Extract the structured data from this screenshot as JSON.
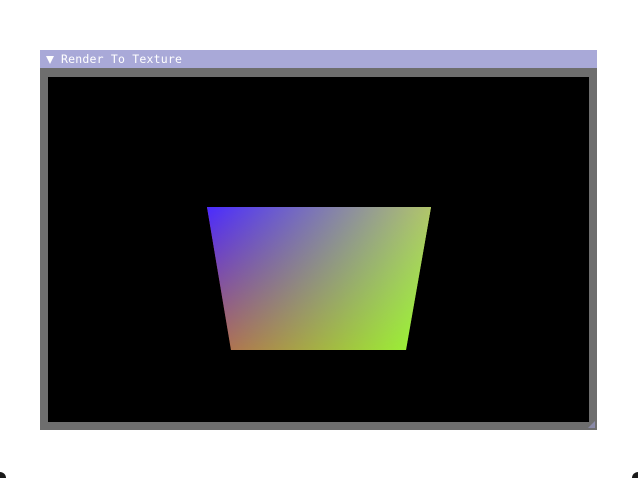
{
  "window": {
    "title": "Render To Texture",
    "collapse_icon": "triangle-down-icon",
    "resize_icon": "resize-grip-icon"
  },
  "scene": {
    "background_color": "#000000",
    "shape": "quad",
    "vertex_colors": {
      "top_left": "#4a2bff",
      "top_right": "#ffff33",
      "bottom_right": "#99ff33",
      "bottom_left": "#ff2a00"
    }
  },
  "theme": {
    "title_bar": "#a9a9d8",
    "frame": "#6e6e6e",
    "title_text": "#ffffff"
  }
}
